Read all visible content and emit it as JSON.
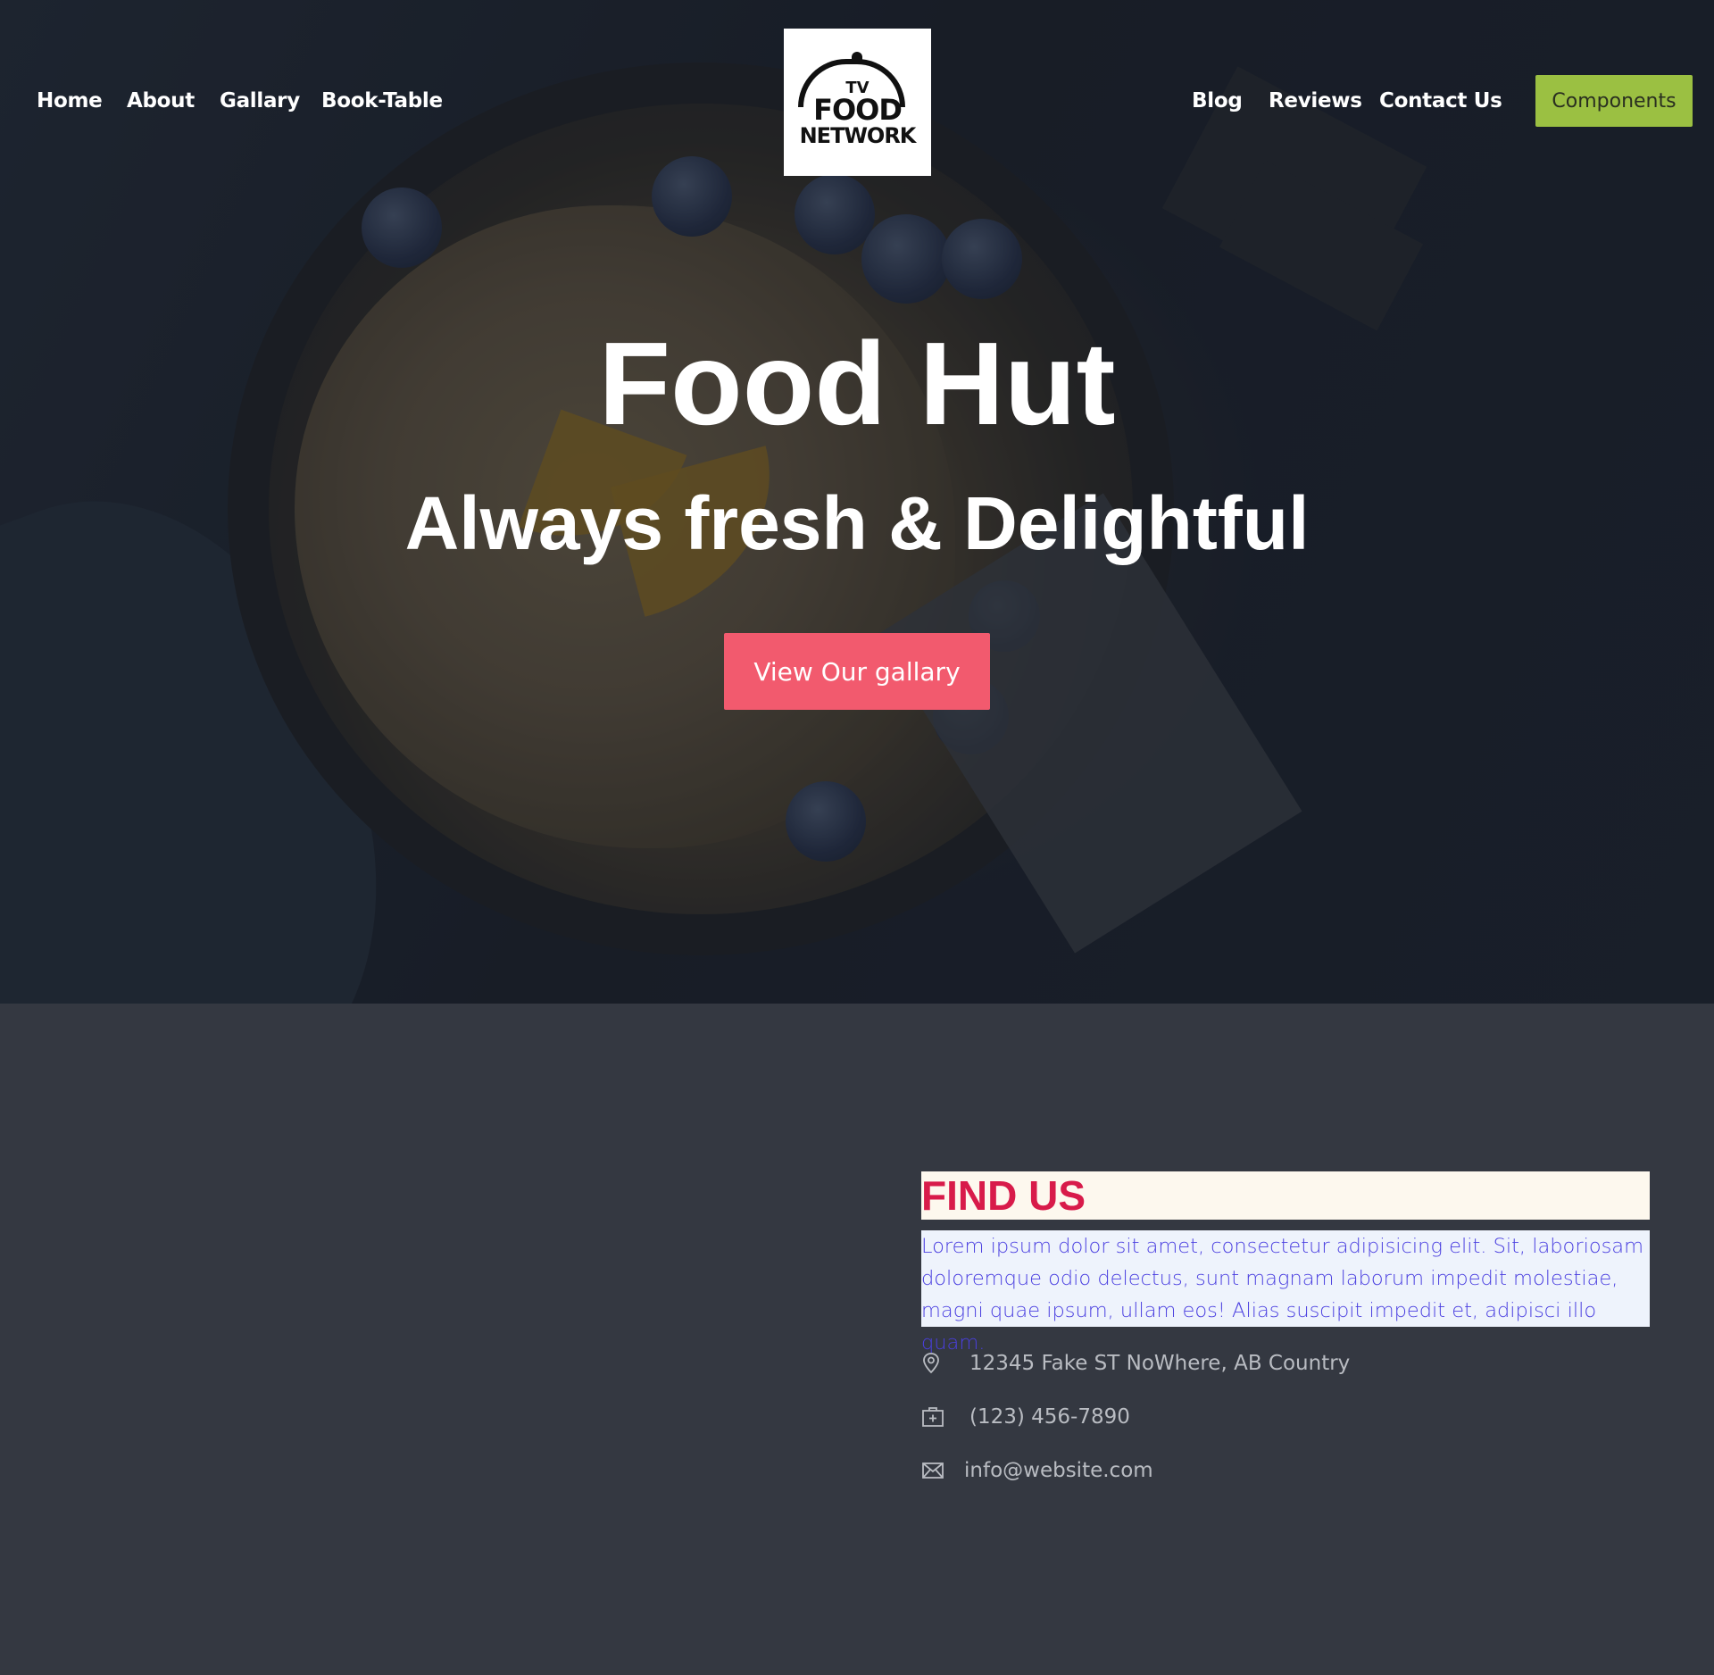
{
  "nav": {
    "left": [
      {
        "label": "Home"
      },
      {
        "label": "About"
      },
      {
        "label": "Gallary"
      },
      {
        "label": "Book-Table"
      }
    ],
    "right": [
      {
        "label": "Blog"
      },
      {
        "label": "Reviews"
      },
      {
        "label": "Contact Us"
      }
    ],
    "components_label": "Components"
  },
  "logo": {
    "line1": "TV",
    "line2": "FOOD",
    "line3": "NETWORK"
  },
  "hero": {
    "title": "Food Hut",
    "subtitle": "Always fresh & Delightful",
    "cta_label": "View Our gallary"
  },
  "find_us": {
    "title": "FIND US",
    "description": "Lorem ipsum dolor sit amet, consectetur adipisicing elit. Sit, laboriosam doloremque odio delectus, sunt magnam laborum impedit molestiae, magni quae ipsum, ullam eos! Alias suscipit impedit et, adipisci illo quam.",
    "address": "12345 Fake ST NoWhere, AB Country",
    "phone": "(123) 456-7890",
    "email": "info@website.com"
  },
  "colors": {
    "accent_button": "#f25a6e",
    "components_button": "#9bc042",
    "find_us_title": "#d81b4a",
    "find_us_text": "#4a3fe0",
    "section_background": "#343841"
  },
  "icons": {
    "address": "map-pin-icon",
    "phone": "phone-box-icon",
    "email": "envelope-icon"
  }
}
